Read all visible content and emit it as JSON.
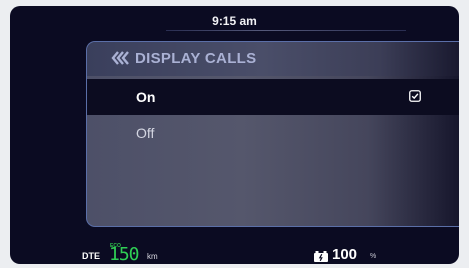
{
  "status": {
    "time": "9:15 am"
  },
  "panel": {
    "title": "DISPLAY CALLS",
    "back_icon": "double-chevron-left-icon",
    "options": [
      {
        "label": "On",
        "selected": true,
        "icon": "checkbox-checked-icon"
      },
      {
        "label": "Off",
        "selected": false
      }
    ]
  },
  "bottom_bar": {
    "dte_label": "DTE",
    "eco_label": "ECO",
    "range_value": "150",
    "range_unit": "km",
    "battery_icon": "battery-icon",
    "battery_value": "100",
    "battery_unit": "%"
  },
  "colors": {
    "background": "#0b0b22",
    "panel_border": "#5b6fa8",
    "header_text": "#aab1d4",
    "range_green": "#2fcf55"
  }
}
